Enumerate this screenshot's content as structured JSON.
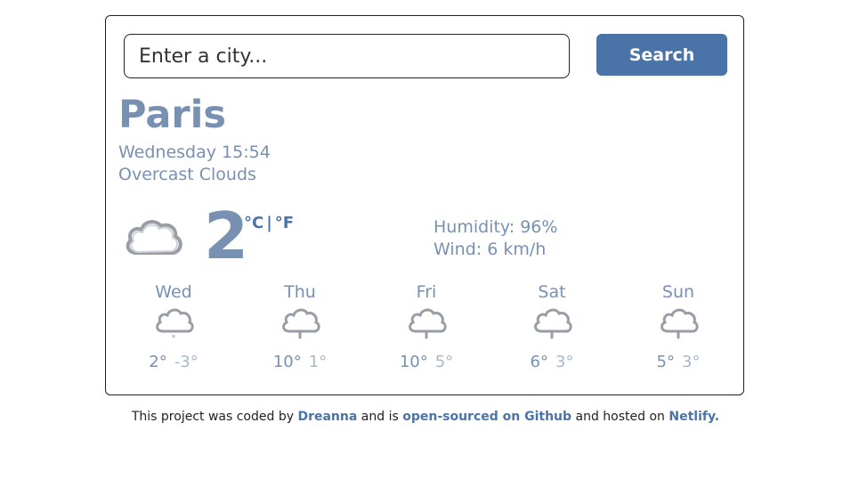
{
  "search": {
    "placeholder": "Enter a city...",
    "button_label": "Search"
  },
  "current": {
    "city": "Paris",
    "datetime": "Wednesday 15:54",
    "description": "Overcast Clouds",
    "icon": "cloud-icon",
    "temperature": "2",
    "unit_celsius": "°C",
    "unit_separator": "|",
    "unit_fahrenheit": "°F",
    "humidity": "Humidity: 96%",
    "wind": "Wind: 6 km/h"
  },
  "forecast": [
    {
      "day": "Wed",
      "icon": "snow-icon",
      "max": "2°",
      "min": "-3°"
    },
    {
      "day": "Thu",
      "icon": "rain-icon",
      "max": "10°",
      "min": "1°"
    },
    {
      "day": "Fri",
      "icon": "rain-icon",
      "max": "10°",
      "min": "5°"
    },
    {
      "day": "Sat",
      "icon": "rain-icon",
      "max": "6°",
      "min": "3°"
    },
    {
      "day": "Sun",
      "icon": "rain-icon",
      "max": "5°",
      "min": "3°"
    }
  ],
  "footer": {
    "text1": "This project was coded by",
    "author": "Dreanna",
    "text2": "and is",
    "github": "open-sourced on Github",
    "text3": "and hosted on",
    "host": "Netlify."
  },
  "colors": {
    "accent": "#4a74a8",
    "text": "#7890b2",
    "muted": "#a8b8cc"
  }
}
